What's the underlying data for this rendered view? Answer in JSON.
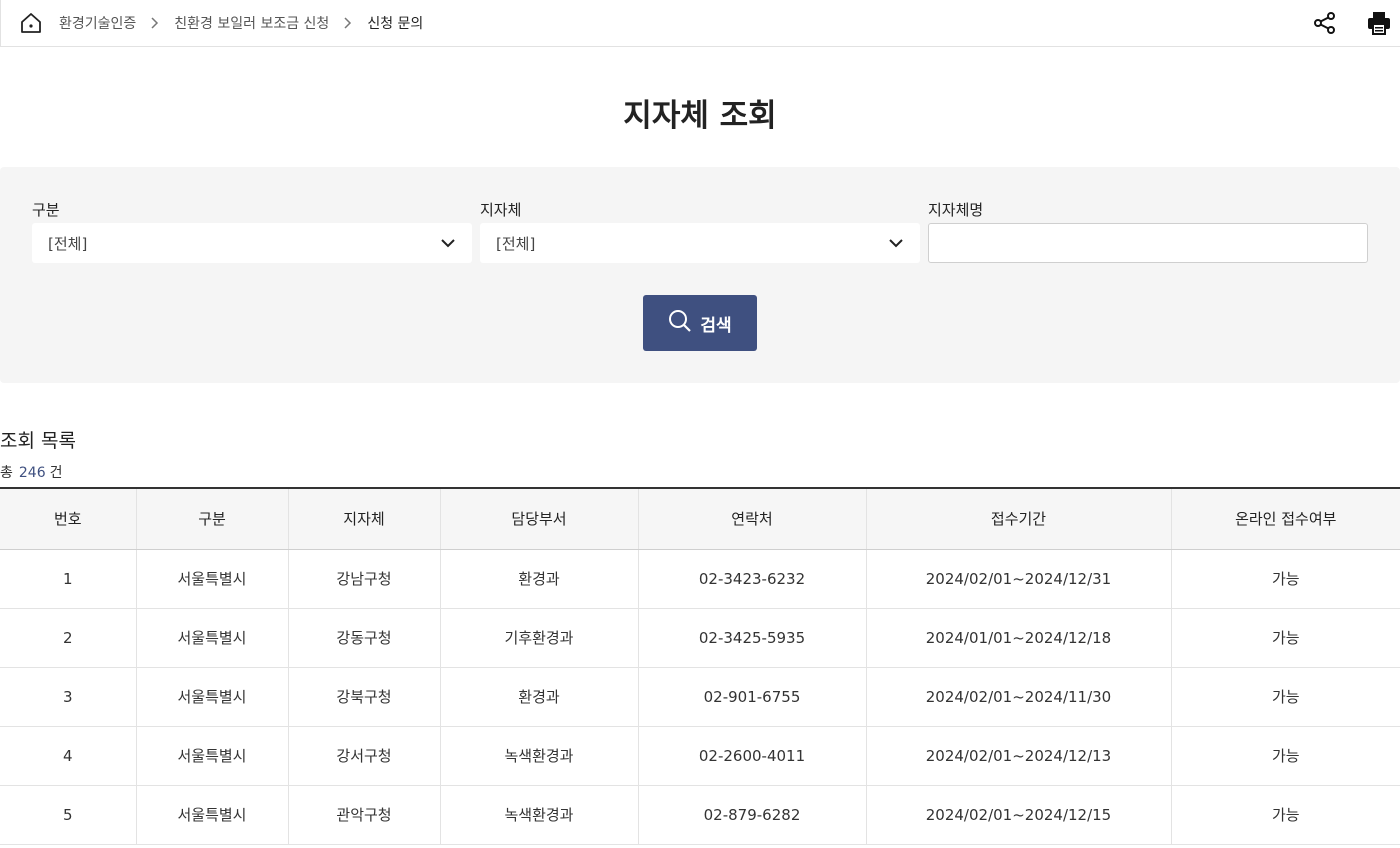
{
  "breadcrumb": {
    "items": [
      "환경기술인증",
      "친환경 보일러 보조금 신청",
      "신청 문의"
    ]
  },
  "page": {
    "title": "지자체 조회"
  },
  "search": {
    "category_label": "구분",
    "category_value": "[전체]",
    "municipality_label": "지자체",
    "municipality_value": "[전체]",
    "name_label": "지자체명",
    "name_value": "",
    "button_label": "검색"
  },
  "results": {
    "title": "조회 목록",
    "count_prefix": "총",
    "count": "246",
    "count_suffix": "건",
    "columns": [
      "번호",
      "구분",
      "지자체",
      "담당부서",
      "연락처",
      "접수기간",
      "온라인 접수여부"
    ],
    "rows": [
      [
        "1",
        "서울특별시",
        "강남구청",
        "환경과",
        "02-3423-6232",
        "2024/02/01~2024/12/31",
        "가능"
      ],
      [
        "2",
        "서울특별시",
        "강동구청",
        "기후환경과",
        "02-3425-5935",
        "2024/01/01~2024/12/18",
        "가능"
      ],
      [
        "3",
        "서울특별시",
        "강북구청",
        "환경과",
        "02-901-6755",
        "2024/02/01~2024/11/30",
        "가능"
      ],
      [
        "4",
        "서울특별시",
        "강서구청",
        "녹색환경과",
        "02-2600-4011",
        "2024/02/01~2024/12/13",
        "가능"
      ],
      [
        "5",
        "서울특별시",
        "관악구청",
        "녹색환경과",
        "02-879-6282",
        "2024/02/01~2024/12/15",
        "가능"
      ]
    ]
  },
  "icons": {
    "home": "home-icon",
    "share": "share-icon",
    "print": "print-icon",
    "search": "search-icon",
    "chevron": "chevron-down-icon"
  },
  "colors": {
    "accent": "#3f5080",
    "panel": "#f5f5f5"
  }
}
